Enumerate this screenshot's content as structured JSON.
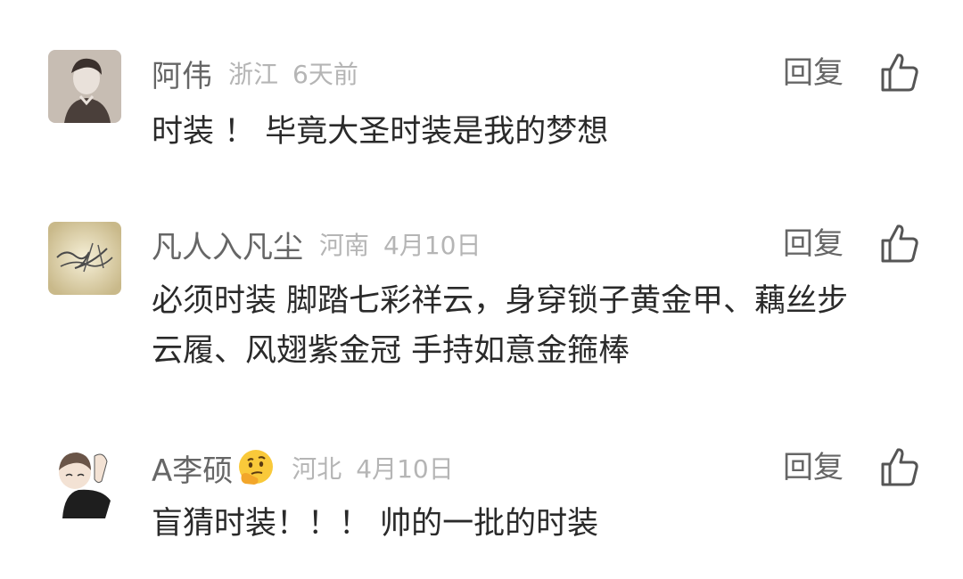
{
  "comments": [
    {
      "user": "阿伟",
      "location": "浙江",
      "date": "6天前",
      "reply_label": "回复",
      "lines": [
        "时装 ！ 毕竟大圣时装是我的梦想"
      ]
    },
    {
      "user": "凡人入凡尘",
      "location": "河南",
      "date": "4月10日",
      "reply_label": "回复",
      "lines": [
        "必须时装 脚踏七彩祥云，身穿锁子黄金甲、藕丝步",
        "云履、风翅紫金冠 手持如意金箍棒"
      ]
    },
    {
      "user": "A李硕",
      "user_emoji": "thinking-face-emoji",
      "location": "河北",
      "date": "4月10日",
      "reply_label": "回复",
      "lines": [
        "盲猜时装！！！ 帅的一批的时装"
      ]
    }
  ],
  "icons": {
    "like": "thumbs-up-icon"
  },
  "colors": {
    "name": "#666666",
    "meta": "#b5b5b5",
    "text": "#2a2a2a",
    "background": "#ffffff"
  }
}
